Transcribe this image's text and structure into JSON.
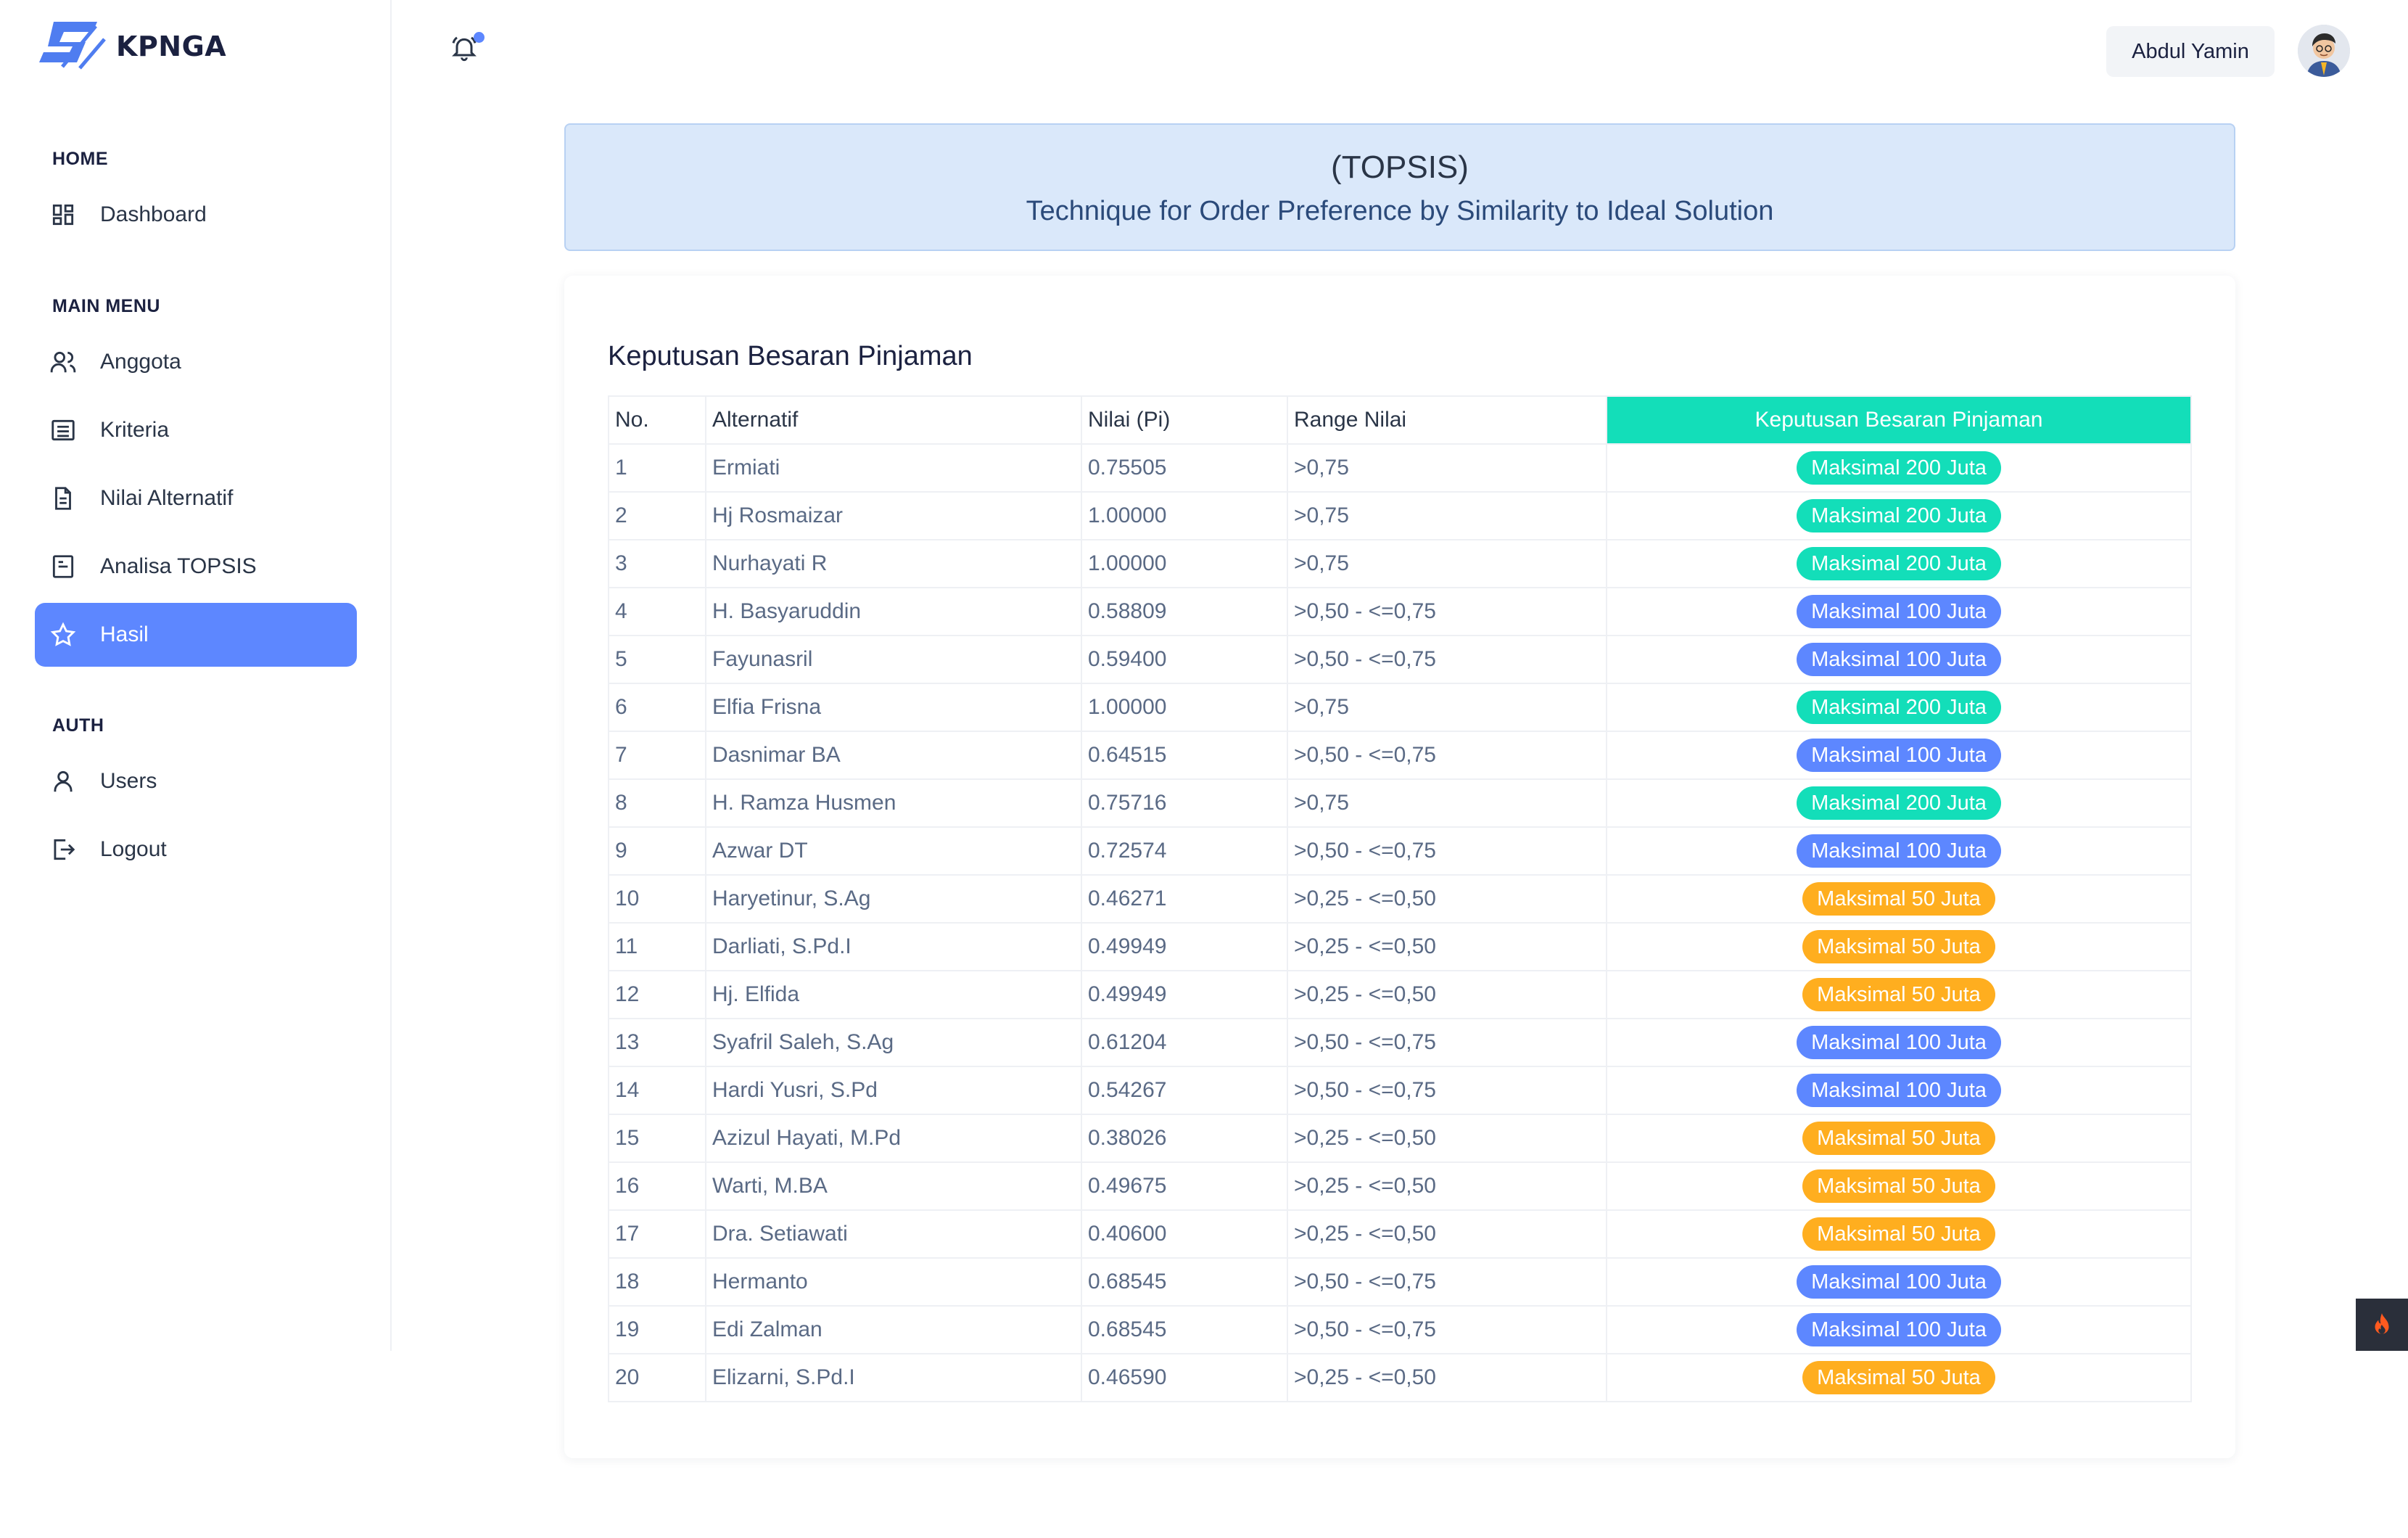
{
  "brand": {
    "name": "KPNGA"
  },
  "sidebar": {
    "sections": {
      "home": "HOME",
      "main_menu": "MAIN MENU",
      "auth": "AUTH"
    },
    "items": {
      "dashboard": "Dashboard",
      "anggota": "Anggota",
      "kriteria": "Kriteria",
      "nilai_alternatif": "Nilai Alternatif",
      "analisa_topsis": "Analisa TOPSIS",
      "hasil": "Hasil",
      "users": "Users",
      "logout": "Logout"
    },
    "active": "Hasil"
  },
  "header": {
    "user_name": "Abdul Yamin",
    "has_notification": true
  },
  "banner": {
    "title": "(TOPSIS)",
    "subtitle": "Technique for Order Preference by Similarity to Ideal Solution"
  },
  "card": {
    "title": "Keputusan Besaran Pinjaman"
  },
  "table": {
    "headers": [
      "No.",
      "Alternatif",
      "Nilai (Pi)",
      "Range Nilai",
      "Keputusan Besaran Pinjaman"
    ],
    "rows": [
      [
        "1",
        "Ermiati",
        "0.75505",
        ">0,75",
        "Maksimal 200 Juta"
      ],
      [
        "2",
        "Hj Rosmaizar",
        "1.00000",
        ">0,75",
        "Maksimal 200 Juta"
      ],
      [
        "3",
        "Nurhayati R",
        "1.00000",
        ">0,75",
        "Maksimal 200 Juta"
      ],
      [
        "4",
        "H. Basyaruddin",
        "0.58809",
        ">0,50 - <=0,75",
        "Maksimal 100 Juta"
      ],
      [
        "5",
        "Fayunasril",
        "0.59400",
        ">0,50 - <=0,75",
        "Maksimal 100 Juta"
      ],
      [
        "6",
        "Elfia Frisna",
        "1.00000",
        ">0,75",
        "Maksimal 200 Juta"
      ],
      [
        "7",
        "Dasnimar BA",
        "0.64515",
        ">0,50 - <=0,75",
        "Maksimal 100 Juta"
      ],
      [
        "8",
        "H. Ramza Husmen",
        "0.75716",
        ">0,75",
        "Maksimal 200 Juta"
      ],
      [
        "9",
        "Azwar DT",
        "0.72574",
        ">0,50 - <=0,75",
        "Maksimal 100 Juta"
      ],
      [
        "10",
        "Haryetinur, S.Ag",
        "0.46271",
        ">0,25 - <=0,50",
        "Maksimal 50 Juta"
      ],
      [
        "11",
        "Darliati, S.Pd.I",
        "0.49949",
        ">0,25 - <=0,50",
        "Maksimal 50 Juta"
      ],
      [
        "12",
        "Hj. Elfida",
        "0.49949",
        ">0,25 - <=0,50",
        "Maksimal 50 Juta"
      ],
      [
        "13",
        "Syafril Saleh, S.Ag",
        "0.61204",
        ">0,50 - <=0,75",
        "Maksimal 100 Juta"
      ],
      [
        "14",
        "Hardi Yusri, S.Pd",
        "0.54267",
        ">0,50 - <=0,75",
        "Maksimal 100 Juta"
      ],
      [
        "15",
        "Azizul Hayati, M.Pd",
        "0.38026",
        ">0,25 - <=0,50",
        "Maksimal 50 Juta"
      ],
      [
        "16",
        "Warti, M.BA",
        "0.49675",
        ">0,25 - <=0,50",
        "Maksimal 50 Juta"
      ],
      [
        "17",
        "Dra. Setiawati",
        "0.40600",
        ">0,25 - <=0,50",
        "Maksimal 50 Juta"
      ],
      [
        "18",
        "Hermanto",
        "0.68545",
        ">0,50 - <=0,75",
        "Maksimal 100 Juta"
      ],
      [
        "19",
        "Edi Zalman",
        "0.68545",
        ">0,50 - <=0,75",
        "Maksimal 100 Juta"
      ],
      [
        "20",
        "Elizarni, S.Pd.I",
        "0.46590",
        ">0,25 - <=0,50",
        "Maksimal 50 Juta"
      ]
    ]
  },
  "badge_colors": {
    "Maksimal 200 Juta": "#13deb9",
    "Maksimal 100 Juta": "#5d87ff",
    "Maksimal 50 Juta": "#ffae1f"
  },
  "icons": {
    "notification": "bell-icon",
    "floating": "fire-icon"
  }
}
